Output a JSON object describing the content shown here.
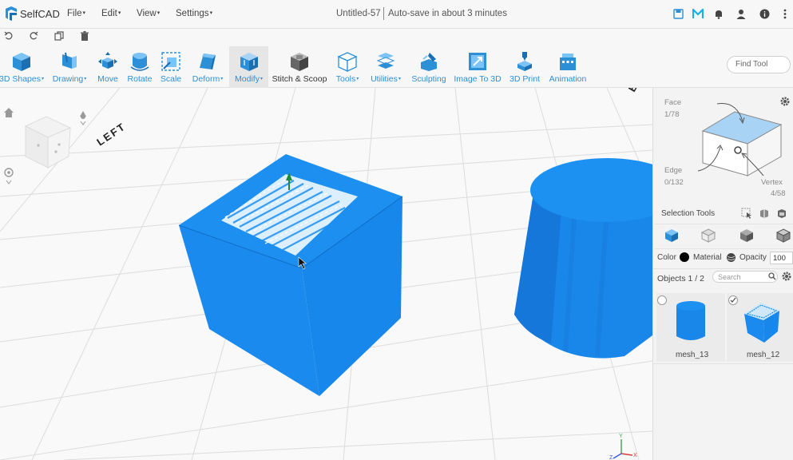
{
  "app": {
    "name": "SelfCAD"
  },
  "menus": [
    {
      "label": "File"
    },
    {
      "label": "Edit"
    },
    {
      "label": "View"
    },
    {
      "label": "Settings"
    }
  ],
  "document": {
    "title": "Untitled-57",
    "autosave": "Auto-save in about 3 minutes"
  },
  "toolbar": {
    "tools": [
      {
        "label": "3D Shapes",
        "icon": "cube-icon"
      },
      {
        "label": "Drawing",
        "icon": "drawing-icon"
      },
      {
        "label": "Move",
        "icon": "move-icon"
      },
      {
        "label": "Rotate",
        "icon": "rotate-icon"
      },
      {
        "label": "Scale",
        "icon": "scale-icon"
      },
      {
        "label": "Deform",
        "icon": "deform-icon"
      },
      {
        "label": "Modify",
        "icon": "modify-icon"
      },
      {
        "label": "Stitch & Scoop",
        "icon": "stitch-icon"
      },
      {
        "label": "Tools",
        "icon": "tools-icon"
      },
      {
        "label": "Utilities",
        "icon": "utilities-icon"
      },
      {
        "label": "Sculpting",
        "icon": "sculpting-icon"
      },
      {
        "label": "Image To 3D",
        "icon": "image-to-3d-icon"
      },
      {
        "label": "3D Print",
        "icon": "3d-print-icon"
      },
      {
        "label": "Animation",
        "icon": "animation-icon"
      }
    ],
    "find_tool_placeholder": "Find Tool"
  },
  "viewport": {
    "view_cube_label": "LEFT",
    "partial_label": "B"
  },
  "selection_panel": {
    "face_label": "Face",
    "face_count": "1/78",
    "edge_label": "Edge",
    "edge_count": "0/132",
    "vertex_label": "Vertex",
    "vertex_count": "4/58",
    "selection_tools_label": "Selection Tools",
    "color_label": "Color",
    "material_label": "Material",
    "opacity_label": "Opacity",
    "opacity_value": "100",
    "objects_label": "Objects 1 / 2",
    "search_placeholder": "Search",
    "objects": [
      {
        "name": "mesh_13",
        "selected": false
      },
      {
        "name": "mesh_12",
        "selected": true
      }
    ]
  },
  "colors": {
    "accent": "#2d8fd6",
    "mesh_blue": "#1e90f0",
    "selected_face": "#a9d3f5"
  }
}
